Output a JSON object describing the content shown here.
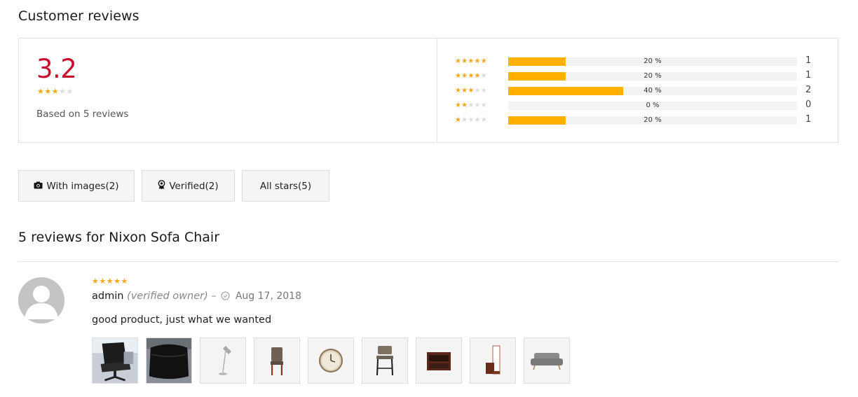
{
  "header": {
    "title": "Customer reviews"
  },
  "summary": {
    "average": "3.2",
    "average_value": 3.2,
    "based_on": "Based on 5 reviews",
    "distribution": [
      {
        "stars": 5,
        "percent_label": "20 %",
        "percent": 20,
        "count": "1"
      },
      {
        "stars": 4,
        "percent_label": "20 %",
        "percent": 20,
        "count": "1"
      },
      {
        "stars": 3,
        "percent_label": "40 %",
        "percent": 40,
        "count": "2"
      },
      {
        "stars": 2,
        "percent_label": "0 %",
        "percent": 0,
        "count": "0"
      },
      {
        "stars": 1,
        "percent_label": "20 %",
        "percent": 20,
        "count": "1"
      }
    ]
  },
  "filters": {
    "with_images": "With images(2)",
    "verified": "Verified(2)",
    "all_stars": "All stars(5)"
  },
  "reviews_section": {
    "title": "5 reviews for Nixon Sofa Chair"
  },
  "review": {
    "rating": 5,
    "author": "admin",
    "verified_label": "(verified owner)",
    "separator": "–",
    "date": "Aug 17, 2018",
    "text": "good product, just what we wanted",
    "images": [
      {
        "icon": "office-chair-photo"
      },
      {
        "icon": "chair-cover-photo"
      },
      {
        "icon": "floor-lamp-icon"
      },
      {
        "icon": "dining-chair-icon"
      },
      {
        "icon": "wall-clock-icon"
      },
      {
        "icon": "bar-stool-icon"
      },
      {
        "icon": "side-table-icon"
      },
      {
        "icon": "mirror-shelf-icon"
      },
      {
        "icon": "sofa-icon"
      }
    ]
  },
  "colors": {
    "accent_red": "#c8102e",
    "star": "#f5a623",
    "bar": "#ffb000"
  }
}
